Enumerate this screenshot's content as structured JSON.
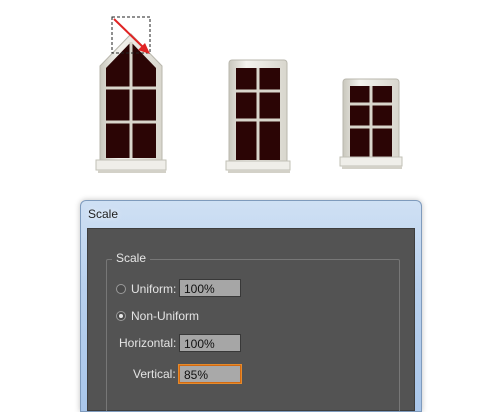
{
  "dialog": {
    "title": "Scale",
    "group_label": "Scale",
    "uniform": {
      "label": "Uniform:",
      "value": "100%",
      "selected": false
    },
    "non_uniform": {
      "label": "Non-Uniform",
      "selected": true
    },
    "horizontal": {
      "label": "Horizontal:",
      "value": "100%"
    },
    "vertical": {
      "label": "Vertical:",
      "value": "85%"
    }
  },
  "colors": {
    "window_glass": "#2b0505",
    "frame": "#e9e8e2",
    "arrow": "#e02424",
    "dialog_body": "#535353",
    "focus": "#e58a2c"
  }
}
